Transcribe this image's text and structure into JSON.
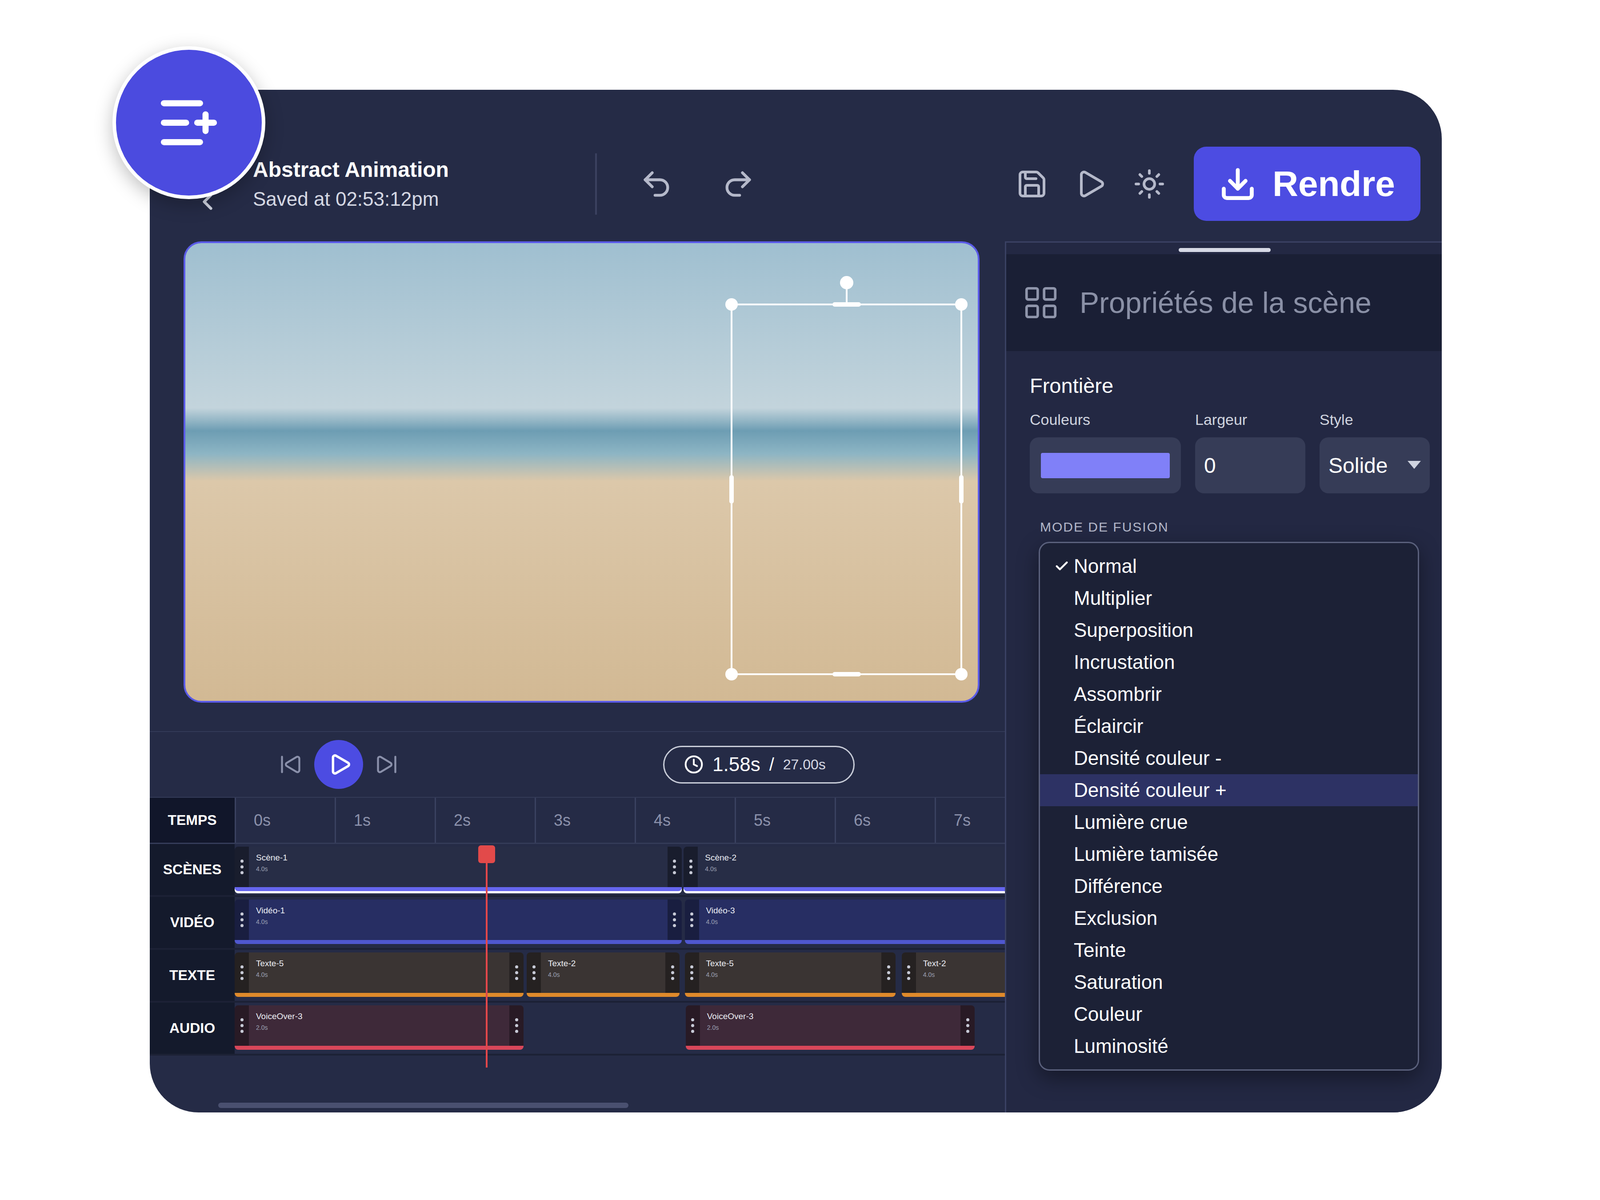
{
  "project": {
    "title": "Abstract Animation",
    "saved": "Saved at 02:53:12pm"
  },
  "toolbar": {
    "render_button": "Rendre"
  },
  "preview": {
    "element_selected": true
  },
  "player": {
    "playing": false,
    "time": "1.58s",
    "separator": "/",
    "duration": "27.00s"
  },
  "timeline": {
    "time_label": "TEMPS",
    "ticks": [
      "0s",
      "1s",
      "2s",
      "3s",
      "4s",
      "5s",
      "6s",
      "7s"
    ],
    "playhead": 2.52,
    "scrollbar": {
      "level": 0.48,
      "position": 0.08
    },
    "tracks": [
      {
        "label": "SCÈNES",
        "kind": "scene",
        "clips": [
          {
            "name": "Scène-1",
            "duration": "4.0s",
            "start": 0,
            "end": 4.47
          },
          {
            "name": "Scène-2",
            "duration": "4.0s",
            "start": 4.49,
            "end": 8.6
          }
        ]
      },
      {
        "label": "VIDÉO",
        "kind": "video",
        "clips": [
          {
            "name": "Vidéo-1",
            "duration": "4.0s",
            "start": 0,
            "end": 4.47
          },
          {
            "name": "Vidéo-3",
            "duration": "4.0s",
            "start": 4.5,
            "end": 8.6
          }
        ]
      },
      {
        "label": "TEXTE",
        "kind": "text",
        "clips": [
          {
            "name": "Texte-5",
            "duration": "4.0s",
            "start": 0,
            "end": 2.89
          },
          {
            "name": "Texte-2",
            "duration": "4.0s",
            "start": 2.92,
            "end": 4.45
          },
          {
            "name": "Texte-5",
            "duration": "4.0s",
            "start": 4.5,
            "end": 6.61
          },
          {
            "name": "Text-2",
            "duration": "4.0s",
            "start": 6.67,
            "end": 8.6
          }
        ]
      },
      {
        "label": "AUDIO",
        "kind": "audio",
        "clips": [
          {
            "name": "VoiceOver-3",
            "duration": "2.0s",
            "start": 0,
            "end": 2.89
          },
          {
            "name": "VoiceOver-3",
            "duration": "2.0s",
            "start": 4.51,
            "end": 7.4
          }
        ]
      }
    ]
  },
  "panel": {
    "title": "Propriétés de la scène",
    "section": "Frontière",
    "fields": [
      {
        "label": "Couleurs",
        "kind": "color",
        "color": "#8080f8"
      },
      {
        "label": "Largeur",
        "kind": "number",
        "value": "0"
      },
      {
        "label": "Style",
        "kind": "select",
        "value": "Solide"
      }
    ],
    "blend_mode": {
      "label": "MODE DE FUSION",
      "open": true,
      "options": [
        {
          "label": "Normal",
          "checked": true,
          "hovered": false
        },
        {
          "label": "Multiplier",
          "checked": false,
          "hovered": false
        },
        {
          "label": "Superposition",
          "checked": false,
          "hovered": false
        },
        {
          "label": "Incrustation",
          "checked": false,
          "hovered": false
        },
        {
          "label": "Assombrir",
          "checked": false,
          "hovered": false
        },
        {
          "label": "Éclaircir",
          "checked": false,
          "hovered": false
        },
        {
          "label": "Densité couleur -",
          "checked": false,
          "hovered": false
        },
        {
          "label": "Densité couleur +",
          "checked": false,
          "hovered": true
        },
        {
          "label": "Lumière crue",
          "checked": false,
          "hovered": false
        },
        {
          "label": "Lumière tamisée",
          "checked": false,
          "hovered": false
        },
        {
          "label": "Différence",
          "checked": false,
          "hovered": false
        },
        {
          "label": "Exclusion",
          "checked": false,
          "hovered": false
        },
        {
          "label": "Teinte",
          "checked": false,
          "hovered": false
        },
        {
          "label": "Saturation",
          "checked": false,
          "hovered": false
        },
        {
          "label": "Couleur",
          "checked": false,
          "hovered": false
        },
        {
          "label": "Luminosité",
          "checked": false,
          "hovered": false
        }
      ]
    }
  }
}
